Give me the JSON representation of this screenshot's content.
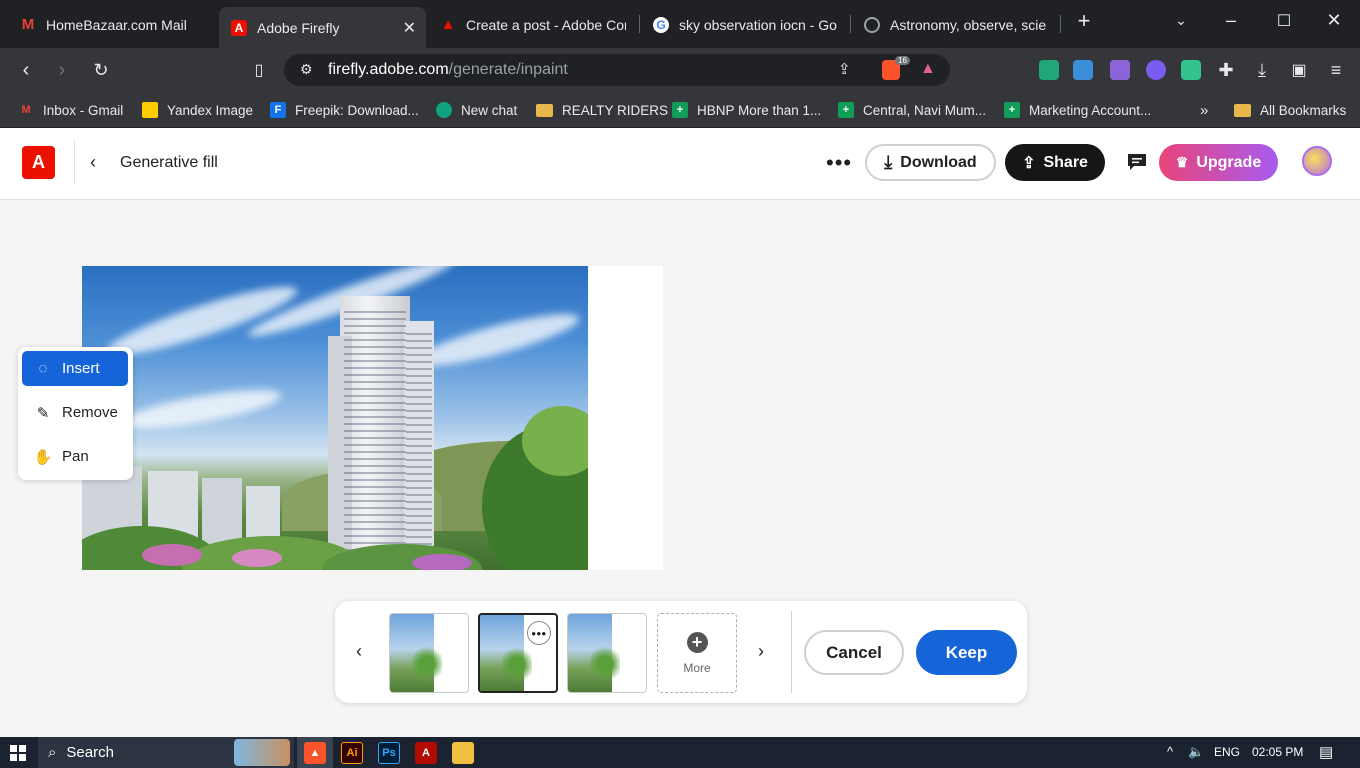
{
  "browser": {
    "tabs": [
      {
        "title": "HomeBazaar.com Mail",
        "icon": "gmail-icon"
      },
      {
        "title": "Adobe Firefly",
        "icon": "adobe-icon",
        "active": true
      },
      {
        "title": "Create a post - Adobe Com",
        "icon": "adobe-icon"
      },
      {
        "title": "sky observation iocn - Goo",
        "icon": "google-icon"
      },
      {
        "title": "Astronomy, observe, scienc",
        "icon": "globe-icon"
      }
    ],
    "url_host": "firefly.adobe.com",
    "url_path": "/generate/inpaint",
    "brave_badge": "16",
    "bookmarks": [
      {
        "label": "Inbox - Gmail"
      },
      {
        "label": "Yandex Image"
      },
      {
        "label": "Freepik: Download..."
      },
      {
        "label": "New chat"
      },
      {
        "label": "REALTY RIDERS"
      },
      {
        "label": "HBNP More than 1..."
      },
      {
        "label": "Central, Navi Mum..."
      },
      {
        "label": "Marketing Account..."
      }
    ],
    "bookmarks_overflow": "»",
    "all_bookmarks": "All Bookmarks"
  },
  "app": {
    "logo_letter": "A",
    "page_title": "Generative fill",
    "download_label": "Download",
    "share_label": "Share",
    "upgrade_label": "Upgrade"
  },
  "tools": [
    {
      "label": "Insert",
      "icon": "insert-icon",
      "active": true
    },
    {
      "label": "Remove",
      "icon": "remove-brush-icon"
    },
    {
      "label": "Pan",
      "icon": "hand-icon"
    }
  ],
  "variations": {
    "more_label": "More",
    "cancel_label": "Cancel",
    "keep_label": "Keep",
    "count": 3,
    "selected_index": 1
  },
  "taskbar": {
    "search_label": "Search",
    "language": "ENG",
    "time": "02:05 PM"
  },
  "colors": {
    "accent_blue": "#1565d8",
    "adobe_red": "#eb1000",
    "share_black": "#161616"
  }
}
